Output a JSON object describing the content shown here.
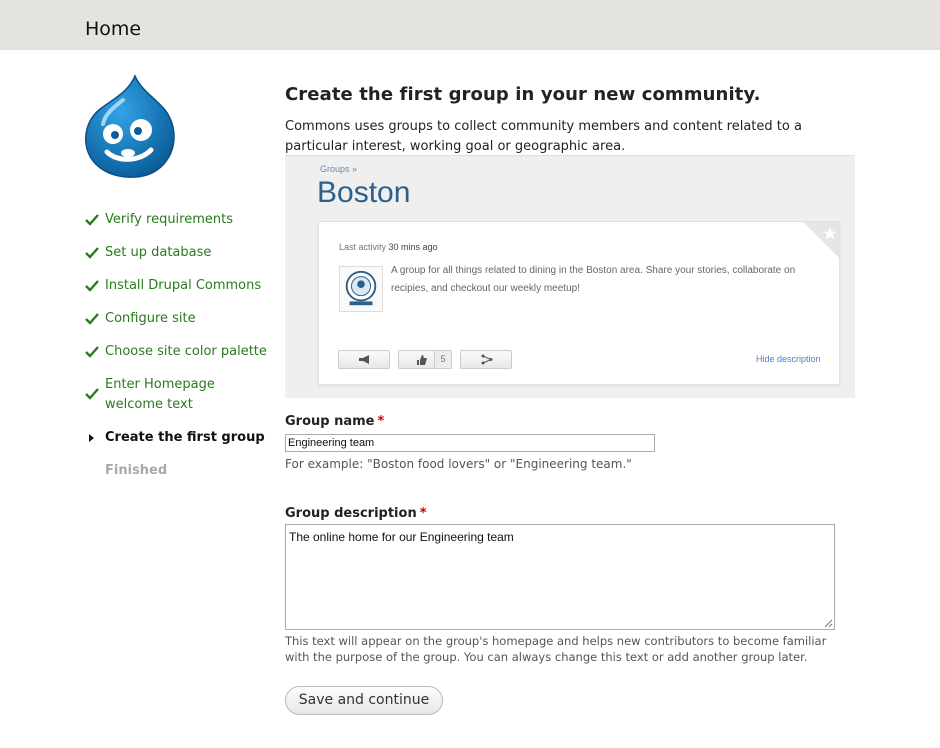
{
  "header": {
    "title": "Home"
  },
  "steps": [
    {
      "label": "Verify requirements",
      "status": "done"
    },
    {
      "label": "Set up database",
      "status": "done"
    },
    {
      "label": "Install Drupal Commons",
      "status": "done"
    },
    {
      "label": "Configure site",
      "status": "done"
    },
    {
      "label": "Choose site color palette",
      "status": "done"
    },
    {
      "label": "Enter Homepage welcome text",
      "status": "done"
    },
    {
      "label": "Create the first group",
      "status": "active"
    },
    {
      "label": "Finished",
      "status": "pending"
    }
  ],
  "main": {
    "heading": "Create the first group in your new community.",
    "intro": "Commons uses groups to collect community members and content related to a particular interest, working goal or geographic area."
  },
  "preview": {
    "breadcrumb": "Groups  »",
    "group_title": "Boston",
    "last_activity_label": "Last activity",
    "last_activity_value": "30 mins ago",
    "description": "A group for all things related to dining in the Boston area. Share your stories, collaborate on recipies, and checkout our weekly meetup!",
    "like_count": "5",
    "hide_description": "Hide description"
  },
  "form": {
    "group_name_label": "Group name",
    "group_name_value": "Engineering team",
    "group_name_hint": "For example: \"Boston food lovers\" or \"Engineering team.\"",
    "group_description_label": "Group description",
    "group_description_value": "The online home for our Engineering team",
    "group_description_hint": "This text will appear on the group's homepage and helps new contributors to become familiar with the purpose of the group. You can always change this text or add another group later.",
    "required_marker": "*",
    "save_label": "Save and continue"
  },
  "colors": {
    "check": "#2a7a1e",
    "header_bg": "#e4e3dd",
    "drupal_blue": "#0a73b5"
  }
}
